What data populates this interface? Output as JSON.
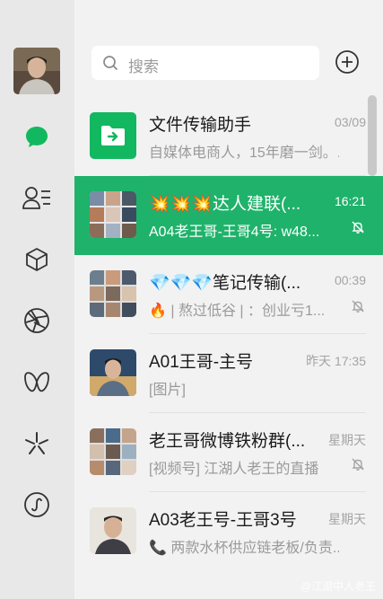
{
  "search": {
    "placeholder": "搜索"
  },
  "nav": [
    {
      "name": "chat-icon"
    },
    {
      "name": "contacts-icon"
    },
    {
      "name": "favorites-icon"
    },
    {
      "name": "moments-icon"
    },
    {
      "name": "channels-icon"
    },
    {
      "name": "discover-icon"
    },
    {
      "name": "mini-programs-icon"
    }
  ],
  "chats": [
    {
      "title": "文件传输助手",
      "time": "03/09",
      "preview": "自媒体电商人，15年磨一剑。..."
    },
    {
      "title": "💥💥💥达人建联(...",
      "time": "16:21",
      "preview": "A04老王哥-王哥4号: w48..."
    },
    {
      "title": "💎💎💎笔记传输(...",
      "time": "00:39",
      "preview": "🔥 | 熬过低谷 | ：创业亏1..."
    },
    {
      "title": "A01王哥-主号",
      "time": "昨天 17:35",
      "preview": "[图片]"
    },
    {
      "title": "老王哥微博铁粉群(...",
      "time": "星期天",
      "preview": "[视频号] 江湖人老王的直播"
    },
    {
      "title": "A03老王号-王哥3号",
      "time": "星期天",
      "preview": "📞 两款水杯供应链老板/负责..."
    }
  ],
  "watermark": "@江湖中人老王",
  "colors": {
    "accent": "#1fb26b",
    "file_icon": "#12b85f",
    "chat_icon": "#12b85f"
  }
}
